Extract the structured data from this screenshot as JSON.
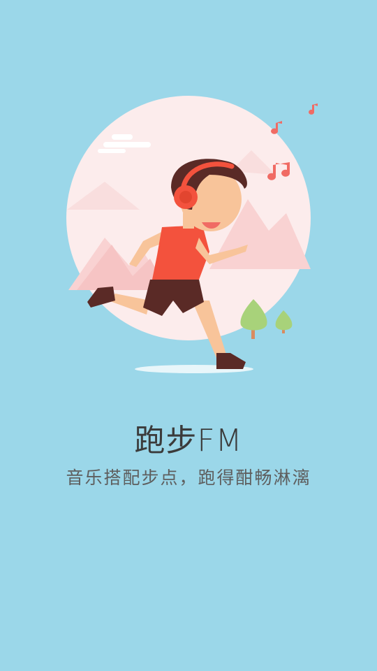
{
  "splash": {
    "title": "跑步FM",
    "slogan": "音乐搭配步点，跑得酣畅淋漓"
  },
  "colors": {
    "background": "#9bd7e9",
    "accent": "#f3523d",
    "circle": "#fcecec"
  }
}
